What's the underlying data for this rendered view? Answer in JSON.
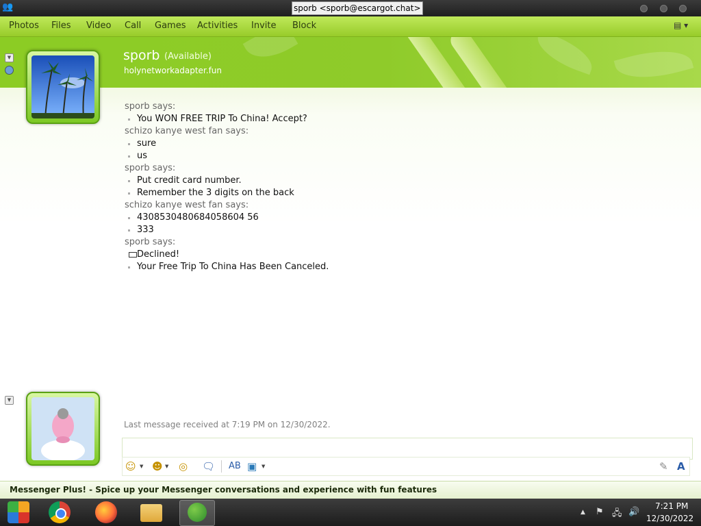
{
  "window": {
    "title": "sporb <sporb@escargot.chat>"
  },
  "menu": {
    "items": [
      "Photos",
      "Files",
      "Video",
      "Call",
      "Games",
      "Activities",
      "Invite",
      "Block"
    ],
    "options_icon": "options-icon"
  },
  "contact": {
    "name": "sporb",
    "status": "(Available)",
    "personal_message": "holynetworkadapter.fun",
    "avatar": "palm-trees"
  },
  "conversation": [
    {
      "speaker": "sporb says:",
      "lines": [
        {
          "text": "You WON FREE TRIP To China! Accept?",
          "bullet": "dot"
        }
      ]
    },
    {
      "speaker": "schizo kanye west fan says:",
      "lines": [
        {
          "text": "sure",
          "bullet": "dot"
        },
        {
          "text": "us",
          "bullet": "dot"
        }
      ]
    },
    {
      "speaker": "sporb says:",
      "lines": [
        {
          "text": "Put credit card number.",
          "bullet": "dot"
        },
        {
          "text": "Remember the 3 digits on the back",
          "bullet": "dot"
        }
      ]
    },
    {
      "speaker": "schizo kanye west fan says:",
      "lines": [
        {
          "text": "4308530480684058604 56",
          "bullet": "dot"
        },
        {
          "text": "333",
          "bullet": "dot"
        }
      ]
    },
    {
      "speaker": "sporb says:",
      "lines": [
        {
          "text": "Declined!",
          "bullet": "box"
        },
        {
          "text": "Your Free Trip To China Has Been Canceled.",
          "bullet": "dot"
        }
      ]
    }
  ],
  "status_line": "Last message received at 7:19 PM on 12/30/2022.",
  "input": {
    "value": ""
  },
  "toolbar": {
    "icons": [
      "emoticon-icon",
      "wink-icon",
      "nudge-icon",
      "voice-clip-icon",
      "font-icon",
      "background-icon",
      "handwriting-icon",
      "text-format-icon"
    ]
  },
  "plus_banner": "Messenger Plus! - Spice up your Messenger conversations and experience with fun features",
  "taskbar": {
    "apps": [
      "start-button",
      "chrome-icon",
      "firefox-icon",
      "file-explorer-icon",
      "messenger-icon"
    ],
    "time": "7:21 PM",
    "date": "12/30/2022"
  },
  "colors": {
    "accent": "#8ccc24",
    "menu": "#bfe85a",
    "taskbar": "#2a2a2a"
  }
}
